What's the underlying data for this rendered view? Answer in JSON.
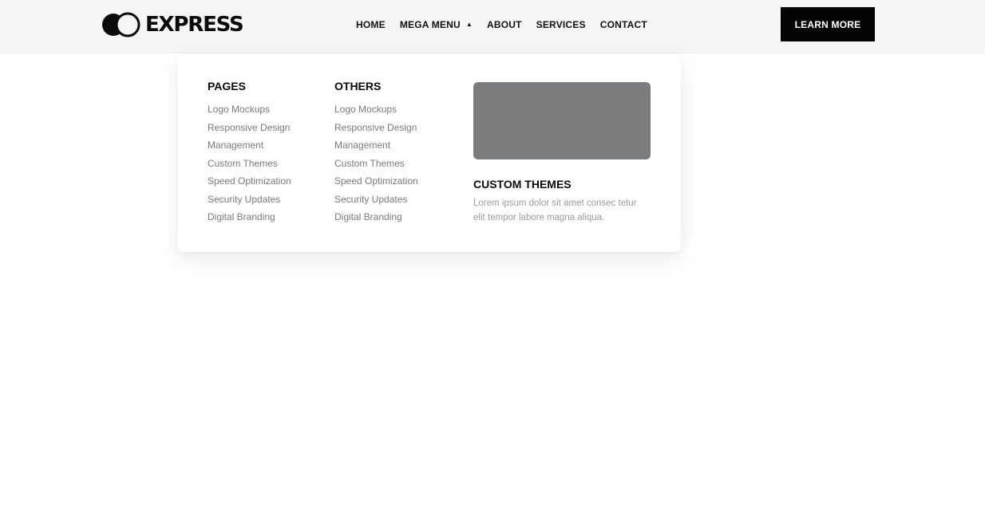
{
  "header": {
    "logo_text": "EXPRESS",
    "logo_icon": "express-logo-icon",
    "nav": [
      {
        "label": "HOME"
      },
      {
        "label": "MEGA MENU",
        "open": true,
        "icon": "caret-up-icon"
      },
      {
        "label": "ABOUT"
      },
      {
        "label": "SERVICES"
      },
      {
        "label": "CONTACT"
      }
    ],
    "cta_label": "LEARN MORE"
  },
  "mega_menu": {
    "pages": {
      "title": "PAGES",
      "items": [
        "Logo Mockups",
        "Responsive Design",
        "Management",
        "Custom Themes",
        "Speed Optimization",
        "Security Updates",
        "Digital Branding"
      ]
    },
    "others": {
      "title": "OTHERS",
      "items": [
        "Logo Mockups",
        "Responsive Design",
        "Management",
        "Custom Themes",
        "Speed Optimization",
        "Security Updates",
        "Digital Branding"
      ]
    },
    "feature": {
      "title": "CUSTOM THEMES",
      "description": "Lorem ipsum dolor sit amet consec tetur elit tempor labore magna aliqua."
    }
  },
  "colors": {
    "header_bg": "#f5f5f5",
    "button_bg": "#050505",
    "placeholder": "#7b7c7d",
    "link_text": "#7a7a7a"
  }
}
